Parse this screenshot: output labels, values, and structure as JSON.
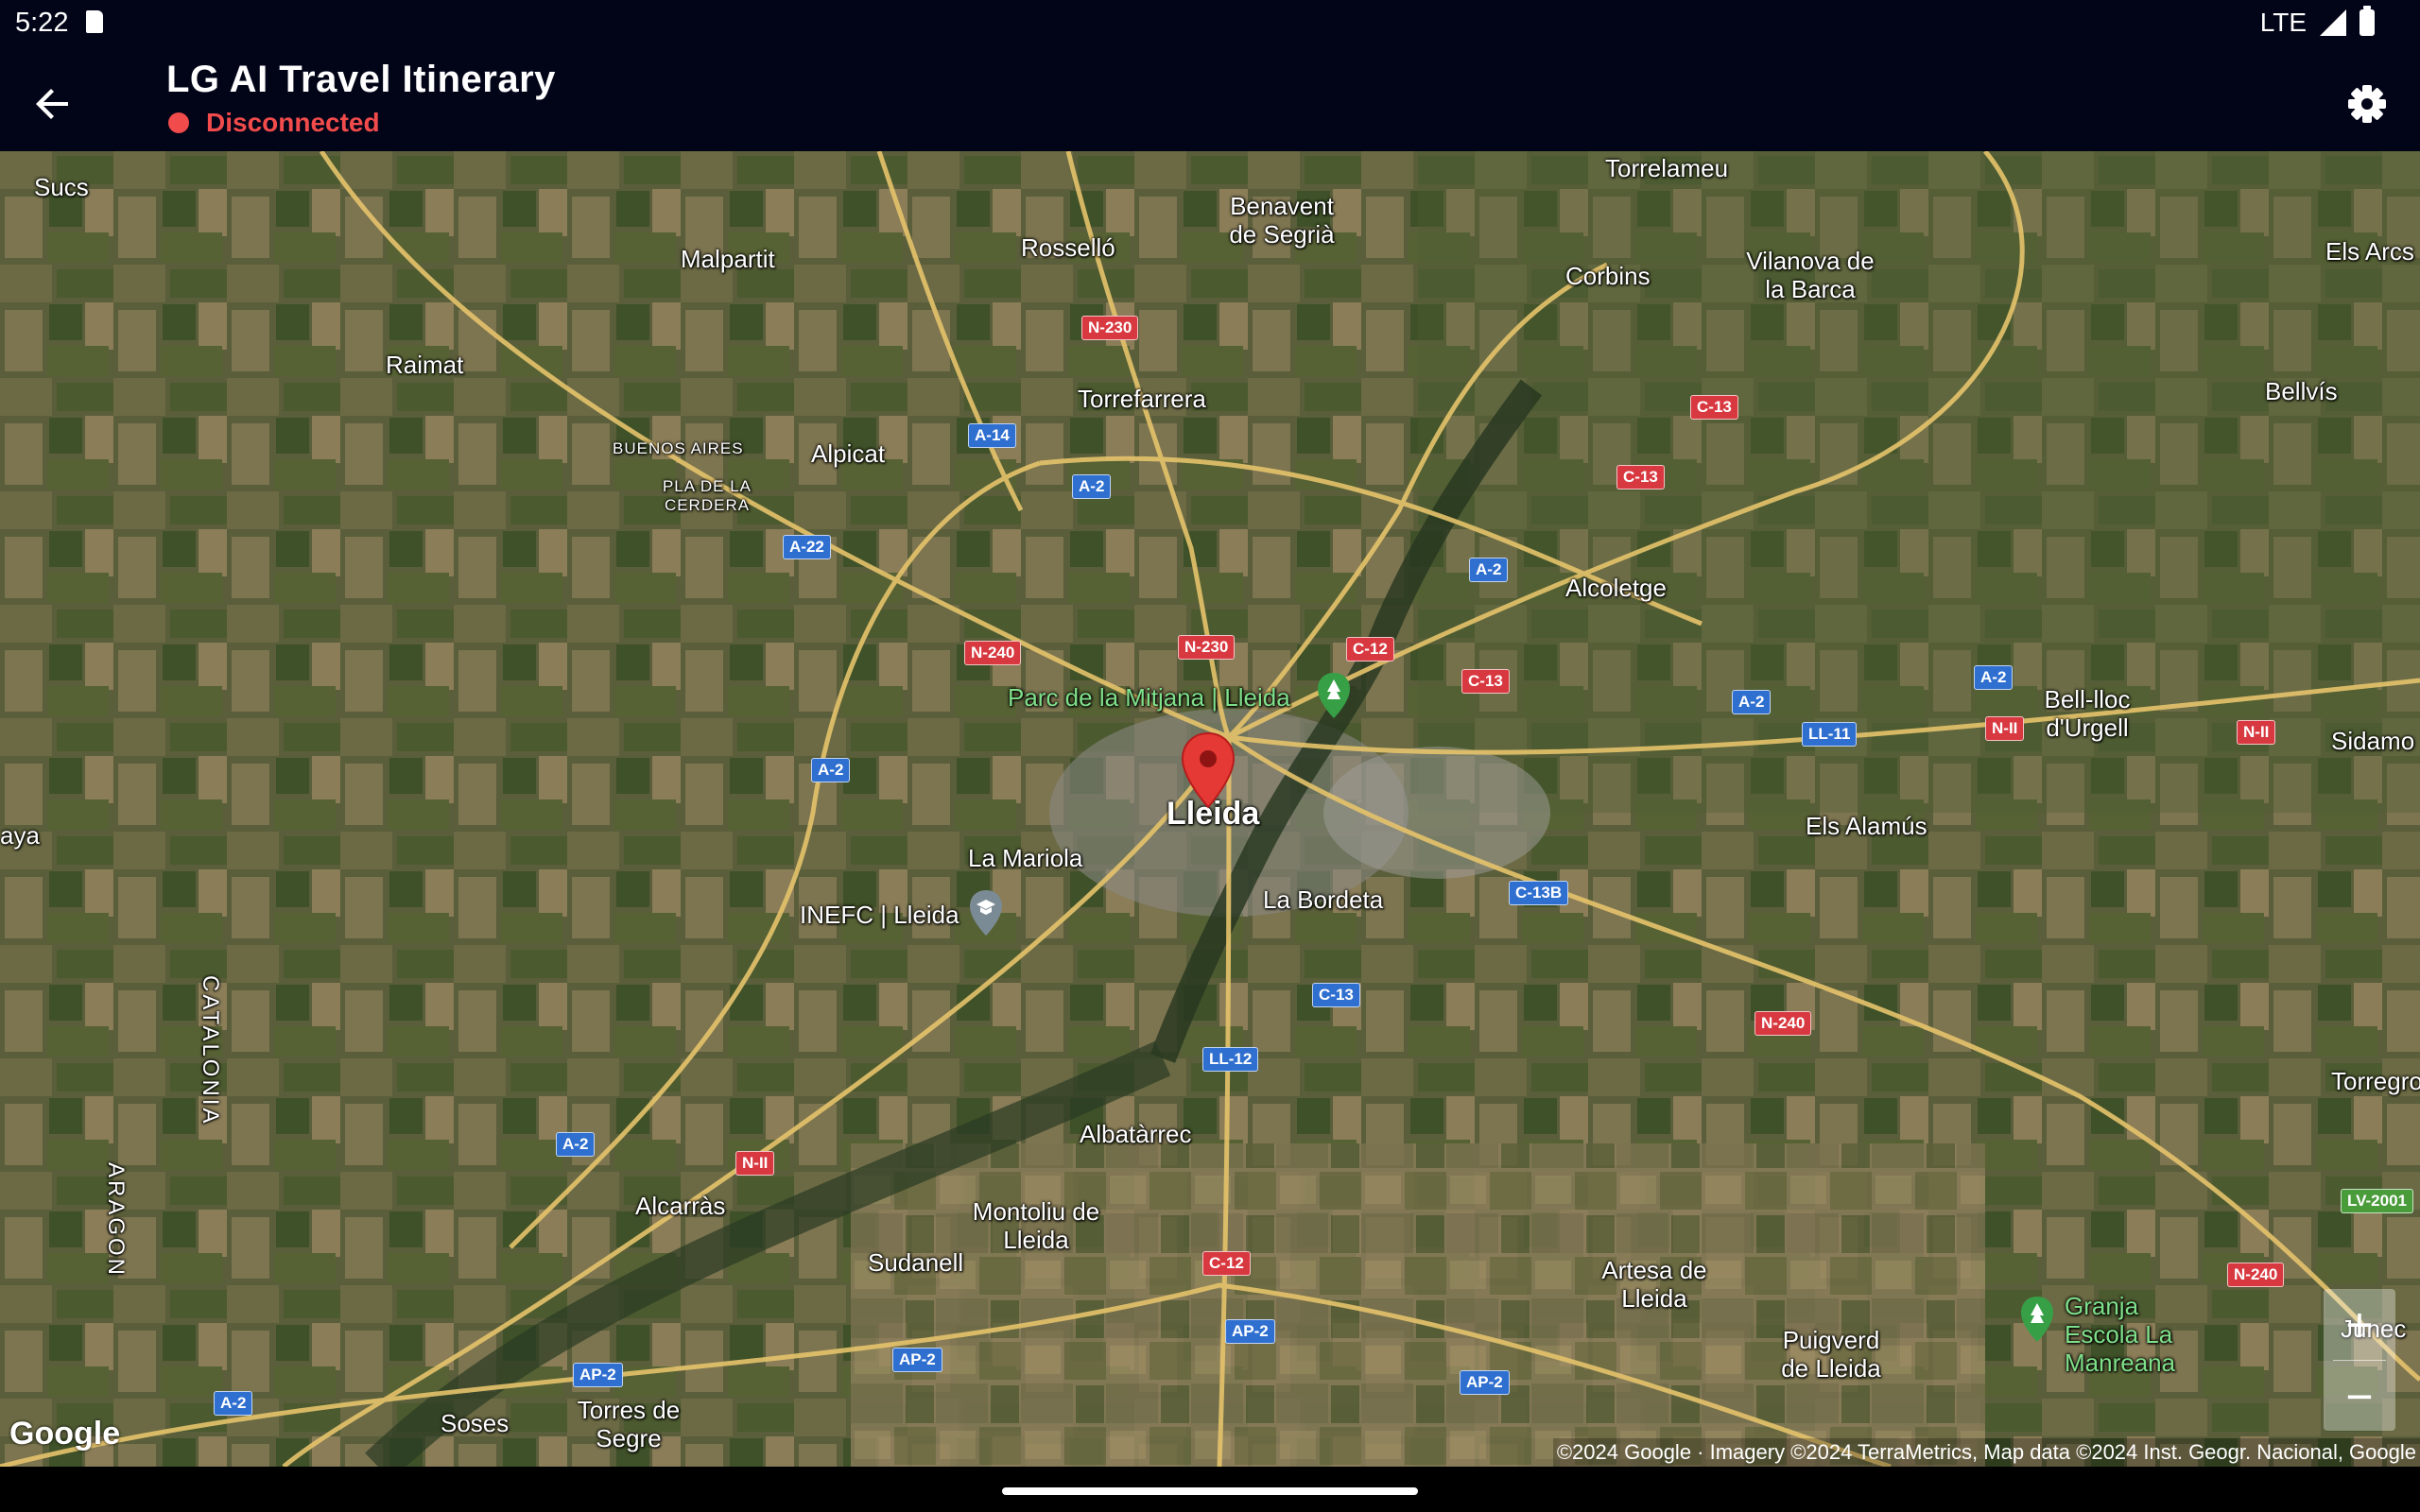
{
  "status_bar": {
    "time": "5:22",
    "network": "LTE"
  },
  "app_bar": {
    "back_icon": "arrow-back-icon",
    "title": "LG AI Travel Itinerary",
    "connection_status": "Disconnected",
    "status_color": "#f24b4b",
    "settings_icon": "gear-icon"
  },
  "map": {
    "type": "satellite",
    "marker_city": "Lleida",
    "places": [
      "Sucs",
      "Malpartit",
      "Rosselló",
      "Benavent de Segrià",
      "Torrelameu",
      "Corbins",
      "Vilanova de la Barca",
      "Els Arcs",
      "Raimat",
      "Bellvís",
      "Torrefarrera",
      "BUENOS AIRES",
      "Alpicat",
      "PLA DE LA CERDERA",
      "Alcoletge",
      "Bell-lloc d'Urgell",
      "Sidamo",
      "La Mariola",
      "Els Alamús",
      "La Bordeta",
      "aya",
      "Torregross",
      "Albatàrrec",
      "Alcarràs",
      "Montoliu de Lleida",
      "Sudanell",
      "Artesa de Lleida",
      "Puigverd de Lleida",
      "Junec",
      "Soses",
      "Torres de Segre"
    ],
    "regions": [
      "ARAGON",
      "CATALONIA"
    ],
    "pois": [
      "Parc de la Mitjana | Lleida",
      "INEFC | Lleida",
      "Granja Escola La Manreana"
    ],
    "road_shields": [
      {
        "label": "N-230",
        "color": "red"
      },
      {
        "label": "N-230",
        "color": "red"
      },
      {
        "label": "A-14",
        "color": "blue"
      },
      {
        "label": "A-2",
        "color": "blue"
      },
      {
        "label": "A-22",
        "color": "blue"
      },
      {
        "label": "C-13",
        "color": "red"
      },
      {
        "label": "C-13",
        "color": "red"
      },
      {
        "label": "A-2",
        "color": "blue"
      },
      {
        "label": "N-240",
        "color": "red"
      },
      {
        "label": "C-12",
        "color": "red"
      },
      {
        "label": "C-13",
        "color": "red"
      },
      {
        "label": "A-2",
        "color": "blue"
      },
      {
        "label": "A-2",
        "color": "blue"
      },
      {
        "label": "LL-11",
        "color": "blue"
      },
      {
        "label": "N-II",
        "color": "red"
      },
      {
        "label": "N-II",
        "color": "red"
      },
      {
        "label": "A-2",
        "color": "blue"
      },
      {
        "label": "C-13B",
        "color": "blue"
      },
      {
        "label": "C-13",
        "color": "blue"
      },
      {
        "label": "N-240",
        "color": "red"
      },
      {
        "label": "LL-12",
        "color": "blue"
      },
      {
        "label": "A-2",
        "color": "blue"
      },
      {
        "label": "N-II",
        "color": "red"
      },
      {
        "label": "LV-2001",
        "color": "green"
      },
      {
        "label": "C-12",
        "color": "red"
      },
      {
        "label": "N-240",
        "color": "red"
      },
      {
        "label": "AP-2",
        "color": "blue"
      },
      {
        "label": "AP-2",
        "color": "blue"
      },
      {
        "label": "AP-2",
        "color": "blue"
      },
      {
        "label": "A-2",
        "color": "blue"
      },
      {
        "label": "AP-2",
        "color": "blue"
      }
    ],
    "google_logo": "Google",
    "attribution": "©2024 Google · Imagery ©2024 TerraMetrics, Map data ©2024 Inst. Geogr. Nacional, Google",
    "zoom_in": "+",
    "zoom_out": "−"
  }
}
